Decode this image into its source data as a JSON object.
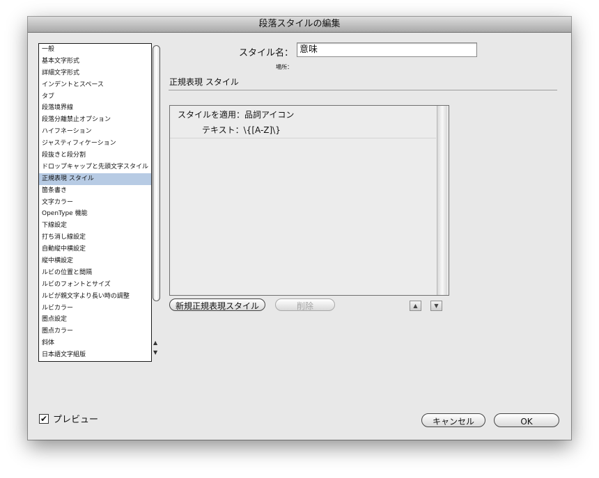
{
  "window": {
    "title": "段落スタイルの編集"
  },
  "categories": {
    "items": [
      "一般",
      "基本文字形式",
      "詳細文字形式",
      "インデントとスペース",
      "タブ",
      "段落境界線",
      "段落分離禁止オプション",
      "ハイフネーション",
      "ジャスティフィケーション",
      "段抜きと段分割",
      "ドロップキャップと先頭文字スタイル",
      "正規表現 スタイル",
      "箇条書き",
      "文字カラー",
      "OpenType 機能",
      "下線設定",
      "打ち消し線設定",
      "自動縦中横設定",
      "縦中横設定",
      "ルビの位置と間隔",
      "ルビのフォントとサイズ",
      "ルビが親文字より長い時の調整",
      "ルビカラー",
      "圏点設定",
      "圏点カラー",
      "斜体",
      "日本語文字組版"
    ],
    "selected_index": 11
  },
  "style_name": {
    "label": "スタイル名：",
    "value": "意味"
  },
  "location": {
    "label": "場所："
  },
  "section": {
    "heading": "正規表現 スタイル"
  },
  "grep_style": {
    "apply_style_label": "スタイルを適用：",
    "apply_style_value": "品詞アイコン",
    "text_label": "テキスト：",
    "text_value": "\\{[A-Z]\\}"
  },
  "buttons": {
    "new_grep_style": "新規正規表現スタイル",
    "delete": "削除",
    "cancel": "キャンセル",
    "ok": "OK"
  },
  "preview": {
    "label": "プレビュー",
    "checked": true
  }
}
